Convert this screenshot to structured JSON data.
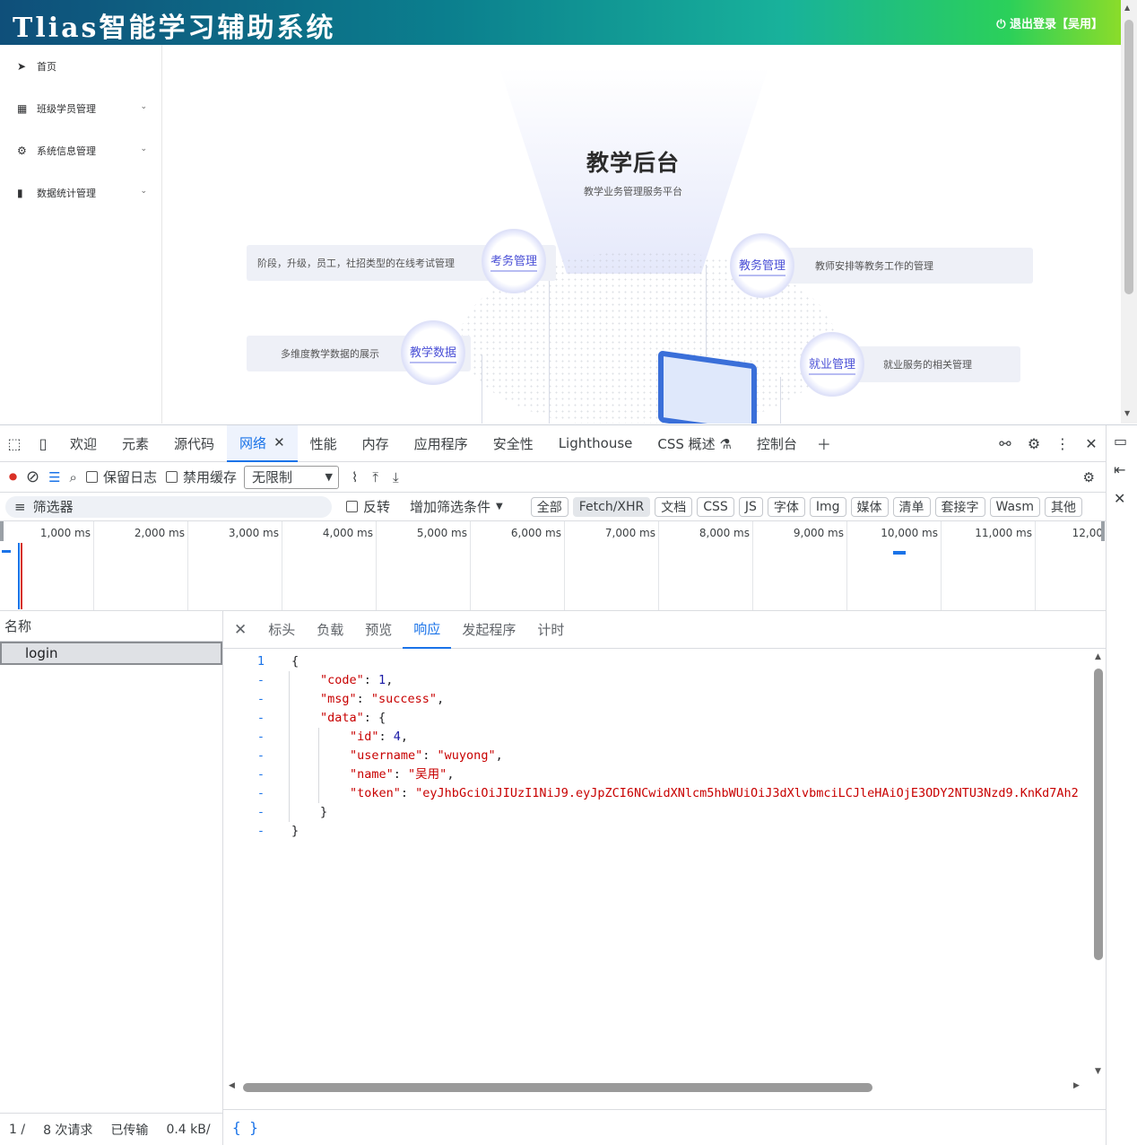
{
  "app": {
    "title": "Tlias智能学习辅助系统",
    "logout": "⏻ 退出登录【吴用】"
  },
  "sidebar": {
    "items": [
      {
        "label": "首页",
        "icon": "send-icon"
      },
      {
        "label": "班级学员管理",
        "icon": "grid-icon"
      },
      {
        "label": "系统信息管理",
        "icon": "gear-icon"
      },
      {
        "label": "数据统计管理",
        "icon": "bar-chart-icon"
      }
    ]
  },
  "hero": {
    "title": "教学后台",
    "subtitle": "教学业务管理服务平台",
    "nodes": [
      {
        "name": "考务管理",
        "desc": "阶段，升级，员工，社招类型的在线考试管理"
      },
      {
        "name": "教务管理",
        "desc": "教师安排等教务工作的管理"
      },
      {
        "name": "教学数据",
        "desc": "多维度教学数据的展示"
      },
      {
        "name": "就业管理",
        "desc": "就业服务的相关管理"
      }
    ]
  },
  "devtools": {
    "tabs": [
      "欢迎",
      "元素",
      "源代码",
      "网络",
      "性能",
      "内存",
      "应用程序",
      "安全性",
      "Lighthouse",
      "CSS 概述 ⚗",
      "控制台"
    ],
    "active_tab": "网络",
    "toolbar": {
      "preserve_log": "保留日志",
      "disable_cache": "禁用缓存",
      "throttle": "无限制"
    },
    "filter": {
      "placeholder": "筛选器",
      "invert": "反转",
      "more_filters": "增加筛选条件",
      "chips": [
        "全部",
        "Fetch/XHR",
        "文档",
        "CSS",
        "JS",
        "字体",
        "Img",
        "媒体",
        "清单",
        "套接字",
        "Wasm",
        "其他"
      ],
      "selected": "Fetch/XHR"
    },
    "timeline": {
      "ticks": [
        "1,000 ms",
        "2,000 ms",
        "3,000 ms",
        "4,000 ms",
        "5,000 ms",
        "6,000 ms",
        "7,000 ms",
        "8,000 ms",
        "9,000 ms",
        "10,000 ms",
        "11,000 ms",
        "12,00"
      ]
    },
    "requests": {
      "header": "名称",
      "items": [
        "login"
      ]
    },
    "status": {
      "count": "1 /",
      "total": "8 次请求",
      "transferred": "已传输",
      "size": "0.4 kB/"
    },
    "detail_tabs": [
      "标头",
      "负载",
      "预览",
      "响应",
      "发起程序",
      "计时"
    ],
    "active_detail_tab": "响应",
    "response": {
      "line1": "1",
      "dash": "-",
      "open": "{",
      "code_key": "\"code\"",
      "code_val": "1",
      "msg_key": "\"msg\"",
      "msg_val": "\"success\"",
      "data_key": "\"data\"",
      "id_key": "\"id\"",
      "id_val": "4",
      "username_key": "\"username\"",
      "username_val": "\"wuyong\"",
      "name_key": "\"name\"",
      "name_val": "\"吴用\"",
      "token_key": "\"token\"",
      "token_val": "\"eyJhbGciOiJIUzI1NiJ9.eyJpZCI6NCwidXNlcm5hbWUiOiJ3dXlvbmciLCJleHAiOjE3ODY2NTU3Nzd9.KnKd7Ah2",
      "close": "}"
    },
    "footer_icon": "{ }"
  }
}
